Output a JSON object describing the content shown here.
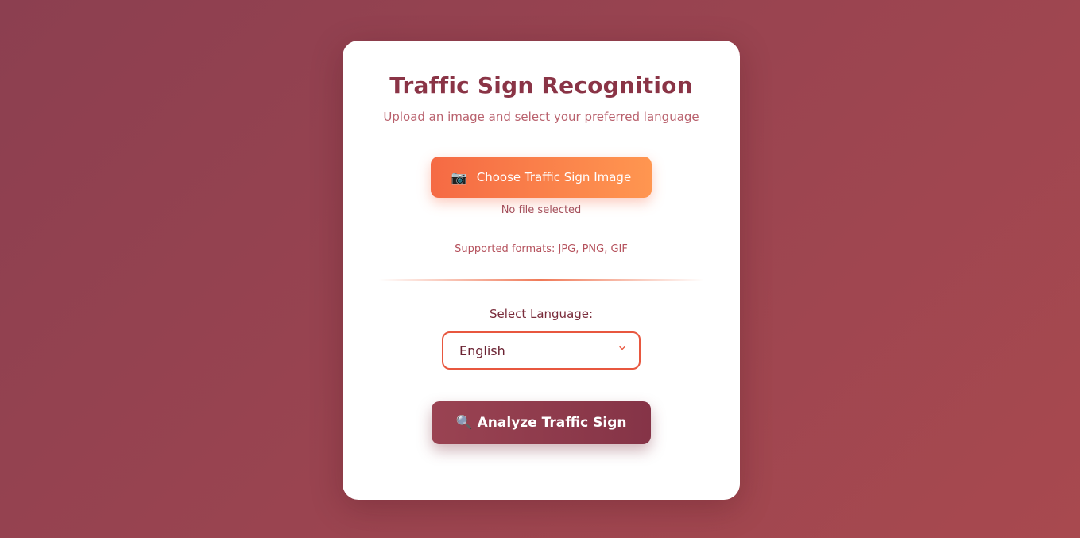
{
  "header": {
    "title": "Traffic Sign Recognition",
    "subtitle": "Upload an image and select your preferred language"
  },
  "upload": {
    "icon": "camera-icon",
    "icon_glyph": "📷",
    "button_label": "Choose Traffic Sign Image",
    "file_status": "No file selected",
    "formats_note": "Supported formats: JPG, PNG, GIF"
  },
  "language": {
    "label": "Select Language:",
    "selected": "English"
  },
  "analyze": {
    "icon": "magnifier-icon",
    "icon_glyph": "🔍",
    "button_label": "Analyze Traffic Sign"
  },
  "colors": {
    "accent_orange": "#f56a44",
    "brand_maroon": "#8a3446",
    "select_border": "#e8573f"
  }
}
